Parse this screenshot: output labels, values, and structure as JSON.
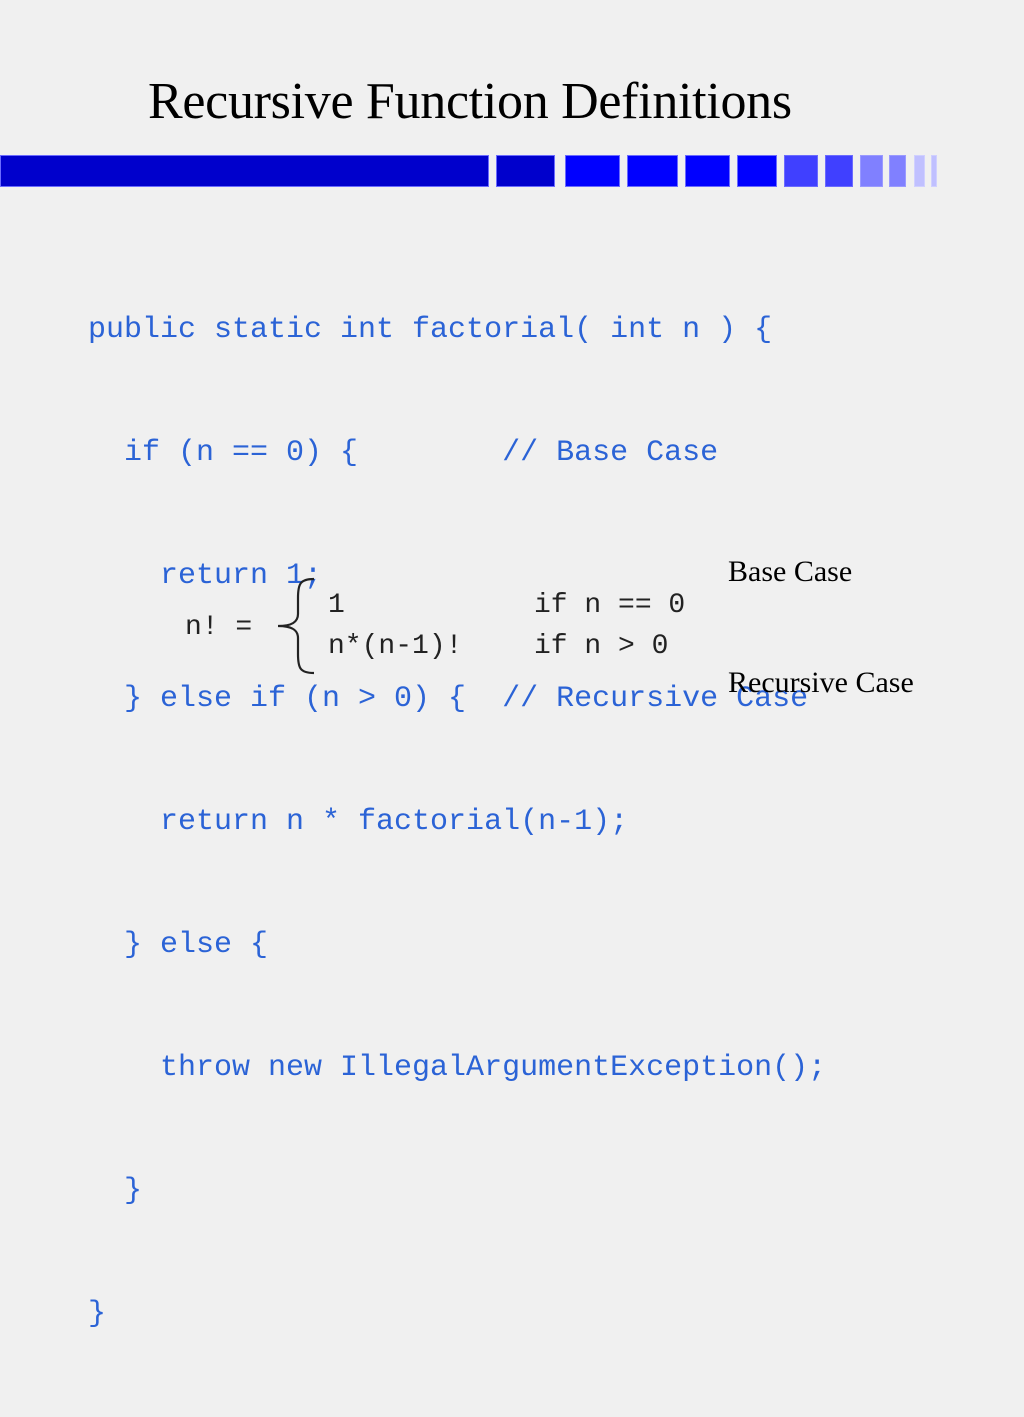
{
  "slide": {
    "title": "Recursive Function Definitions",
    "accent_colors": {
      "dark_blue": "#0000cc",
      "blue": "#0000ff",
      "medium_blue": "#4040ff",
      "light_blue": "#8080ff",
      "pale_blue": "#c0c0ff",
      "code_text": "#2b63d6"
    },
    "code_lines": [
      "public static int factorial( int n ) {",
      "  if (n == 0) {        // Base Case",
      "    return 1;",
      "  } else if (n > 0) {  // Recursive Case",
      "    return n * factorial(n-1);",
      "  } else {",
      "    throw new IllegalArgumentException();",
      "  }",
      "}"
    ],
    "formula": {
      "lhs": "n! =",
      "cases": [
        {
          "value": "1",
          "condition": "if n == 0"
        },
        {
          "value": "n*(n-1)!",
          "condition": "if n > 0"
        }
      ]
    },
    "labels": {
      "base_case": "Base Case",
      "recursive_case": "Recursive Case"
    }
  }
}
